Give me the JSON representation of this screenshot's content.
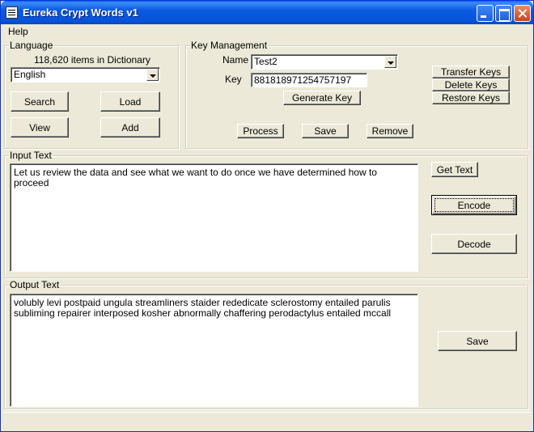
{
  "window": {
    "title": "Eureka Crypt Words v1"
  },
  "menu": {
    "help": "Help"
  },
  "language": {
    "legend": "Language",
    "count": "118,620 items in Dictionary",
    "selected": "English",
    "search": "Search",
    "load": "Load",
    "view": "View",
    "add": "Add"
  },
  "key_management": {
    "legend": "Key Management",
    "name_label": "Name",
    "name_value": "Test2",
    "key_label": "Key",
    "key_value": "881818971254757197",
    "generate": "Generate Key",
    "transfer": "Transfer Keys",
    "delete": "Delete Keys",
    "restore": "Restore Keys",
    "process": "Process",
    "save": "Save",
    "remove": "Remove"
  },
  "input": {
    "legend": "Input Text",
    "text": "Let us review the data and see what we want to do once we have determined how to proceed",
    "get_text": "Get Text",
    "encode": "Encode",
    "decode": "Decode"
  },
  "output": {
    "legend": "Output Text",
    "text": "volubly levi postpaid ungula streamliners staider rededicate sclerostomy entailed parulis subliming repairer interposed kosher abnormally chaffering perodactylus entailed mccall",
    "save": "Save"
  }
}
